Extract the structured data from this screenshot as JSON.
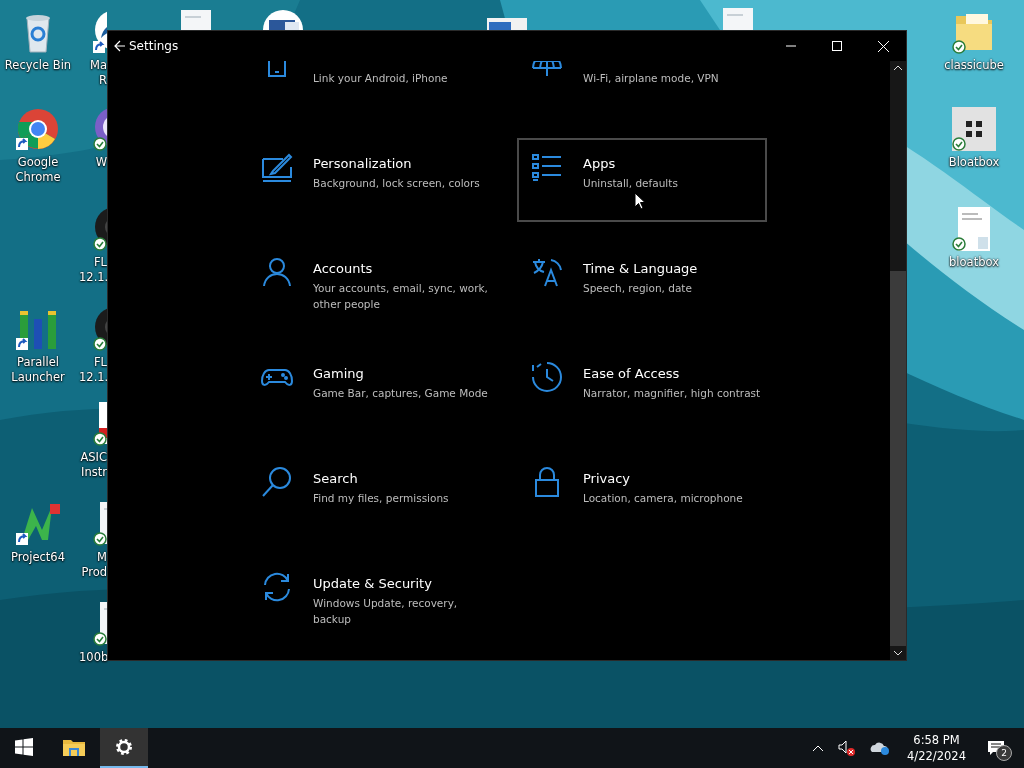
{
  "desktop": {
    "icons": [
      {
        "kind": "recycle",
        "label": "Recycle Bin",
        "shortcut": false,
        "synced": false
      },
      {
        "kind": "chrome",
        "label": "Google Chrome",
        "shortcut": true,
        "synced": false
      },
      {
        "kind": "parallel",
        "label": "Parallel Launcher",
        "shortcut": true,
        "synced": false
      },
      {
        "kind": "project64",
        "label": "Project64",
        "shortcut": true,
        "synced": false
      },
      {
        "kind": "arrow",
        "label": "Ma\nR",
        "shortcut": true,
        "synced": false
      },
      {
        "kind": "purple",
        "label": "W",
        "shortcut": false,
        "synced": true
      },
      {
        "kind": "dark",
        "label": "FL\n12.1.",
        "shortcut": false,
        "synced": true
      },
      {
        "kind": "dark",
        "label": "FL\n12.1.",
        "shortcut": false,
        "synced": true
      },
      {
        "kind": "pdf",
        "label": "ASIC\nInstr",
        "shortcut": false,
        "synced": true
      },
      {
        "kind": "page",
        "label": "M\nProd",
        "shortcut": false,
        "synced": true
      },
      {
        "kind": "page",
        "label": "100b",
        "shortcut": false,
        "synced": true
      },
      {
        "kind": "page"
      },
      {
        "kind": "word"
      },
      {
        "kind": "thumb"
      },
      {
        "kind": "page"
      },
      {
        "kind": "folder",
        "label": "classicube",
        "shortcut": false,
        "synced": true
      },
      {
        "kind": "bloatbox",
        "label": "Bloatbox",
        "shortcut": false,
        "synced": true
      },
      {
        "kind": "text",
        "label": "bloatbox",
        "shortcut": false,
        "synced": true
      }
    ]
  },
  "window": {
    "title": "Settings",
    "tiles": [
      {
        "kind": "phone",
        "description": "Link your Android, iPhone",
        "hovered": false
      },
      {
        "kind": "network",
        "description": "Wi-Fi, airplane mode, VPN",
        "hovered": false
      },
      {
        "kind": "personalization",
        "title": "Personalization",
        "description": "Background, lock screen, colors",
        "hovered": false
      },
      {
        "kind": "apps",
        "title": "Apps",
        "description": "Uninstall, defaults",
        "hovered": true
      },
      {
        "kind": "accounts",
        "title": "Accounts",
        "description": "Your accounts, email, sync, work, other people",
        "hovered": false
      },
      {
        "kind": "time",
        "title": "Time & Language",
        "description": "Speech, region, date",
        "hovered": false
      },
      {
        "kind": "gaming",
        "title": "Gaming",
        "description": "Game Bar, captures, Game Mode",
        "hovered": false
      },
      {
        "kind": "ease",
        "title": "Ease of Access",
        "description": "Narrator, magnifier, high contrast",
        "hovered": false
      },
      {
        "kind": "search",
        "title": "Search",
        "description": "Find my files, permissions",
        "hovered": false
      },
      {
        "kind": "privacy",
        "title": "Privacy",
        "description": "Location, camera, microphone",
        "hovered": false
      },
      {
        "kind": "update",
        "title": "Update & Security",
        "description": "Windows Update, recovery, backup",
        "hovered": false
      }
    ]
  },
  "taskbar": {
    "buttons": [
      {
        "kind": "start",
        "selected": false
      },
      {
        "kind": "explorer",
        "selected": false
      },
      {
        "kind": "settings",
        "selected": true
      }
    ],
    "time": "6:58 PM",
    "date": "4/22/2024",
    "notifications": "2"
  }
}
